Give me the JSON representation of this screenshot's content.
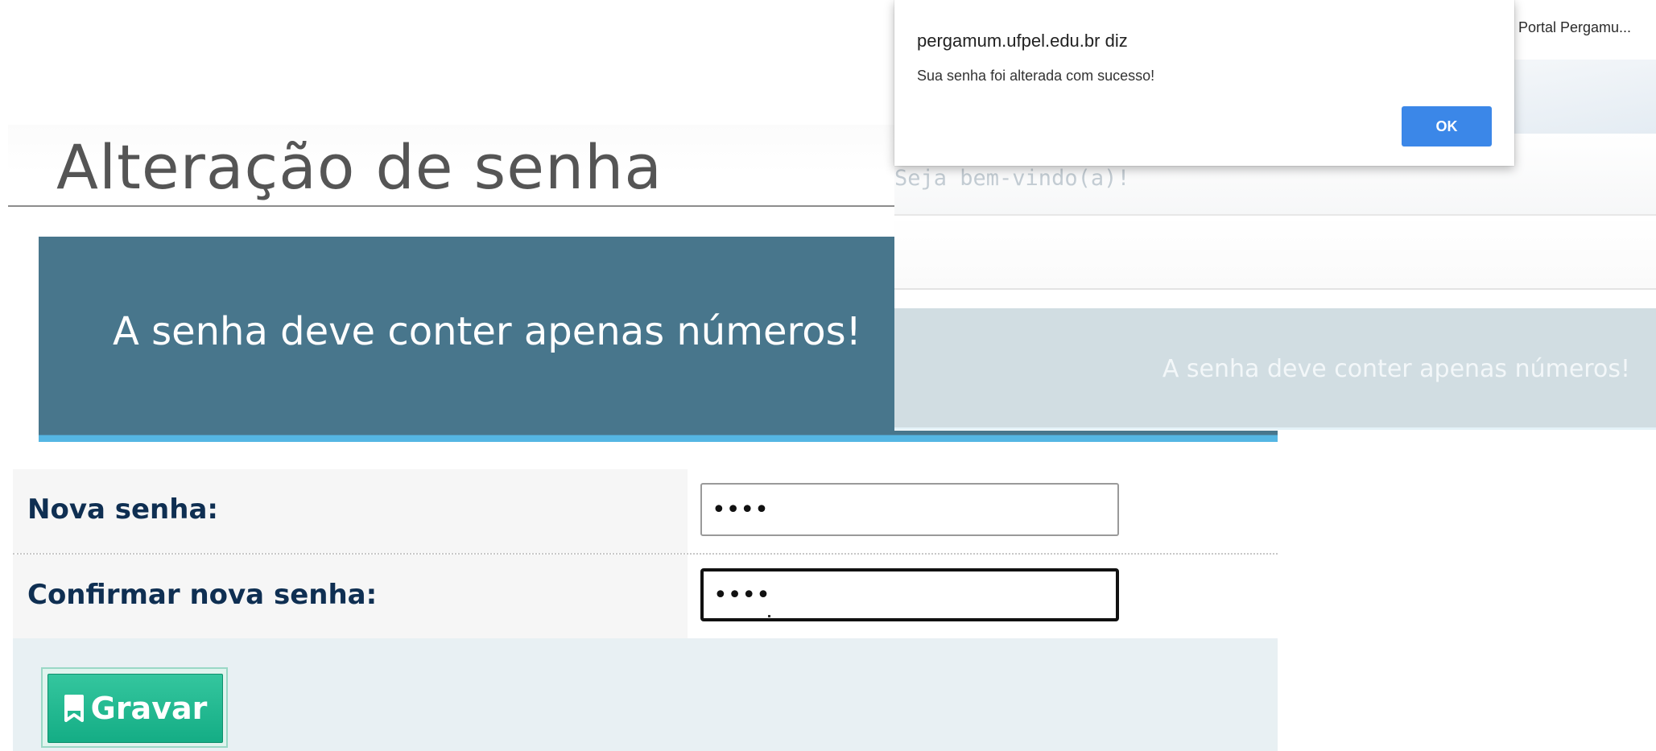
{
  "background_page": {
    "portal_link": "Portal Pergamu...",
    "welcome": "Seja bem-vindo(a)!",
    "banner_text": "A senha deve conter apenas números!"
  },
  "page": {
    "title": "Alteração de senha",
    "alert": "A senha deve conter apenas números!"
  },
  "form": {
    "new_password_label": "Nova senha:",
    "new_password_value": "••••",
    "confirm_password_label": "Confirmar nova senha:",
    "confirm_password_value": "••••",
    "save_label": "Gravar",
    "save_icon": "bookmark-icon"
  },
  "dialog": {
    "origin": "pergamum.ufpel.edu.br diz",
    "message": "Sua senha foi alterada com sucesso!",
    "ok_label": "OK"
  },
  "colors": {
    "alert_banner": "#48768c",
    "accent_line": "#55b6e3",
    "label_text": "#0f2f52",
    "save_button": "#1ab88e",
    "dialog_ok": "#3b87e8"
  }
}
